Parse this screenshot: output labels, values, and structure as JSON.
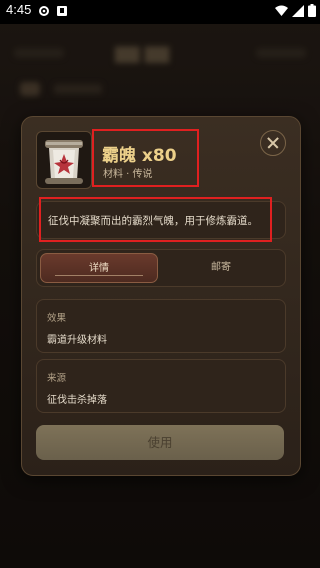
{
  "status_bar": {
    "time": "4:45"
  },
  "item": {
    "name_with_count": "霸魄 x80",
    "subtitle": "材料 · 传说",
    "description": "征伐中凝聚而出的霸烈气魄，用于修炼霸道。",
    "icon": "scroll-icon"
  },
  "tabs": [
    {
      "label": "详情",
      "active": true
    },
    {
      "label": "邮寄",
      "active": false
    }
  ],
  "sections": {
    "effect": {
      "label": "效果",
      "value": "霸道升级材料"
    },
    "source": {
      "label": "来源",
      "value": "征伐击杀掉落"
    }
  },
  "actions": {
    "use_label": "使用"
  },
  "colors": {
    "title": "#ecd08a",
    "highlight": "#e02020",
    "active_tab": "#6a3a2c",
    "use_button": "#7e7258"
  }
}
